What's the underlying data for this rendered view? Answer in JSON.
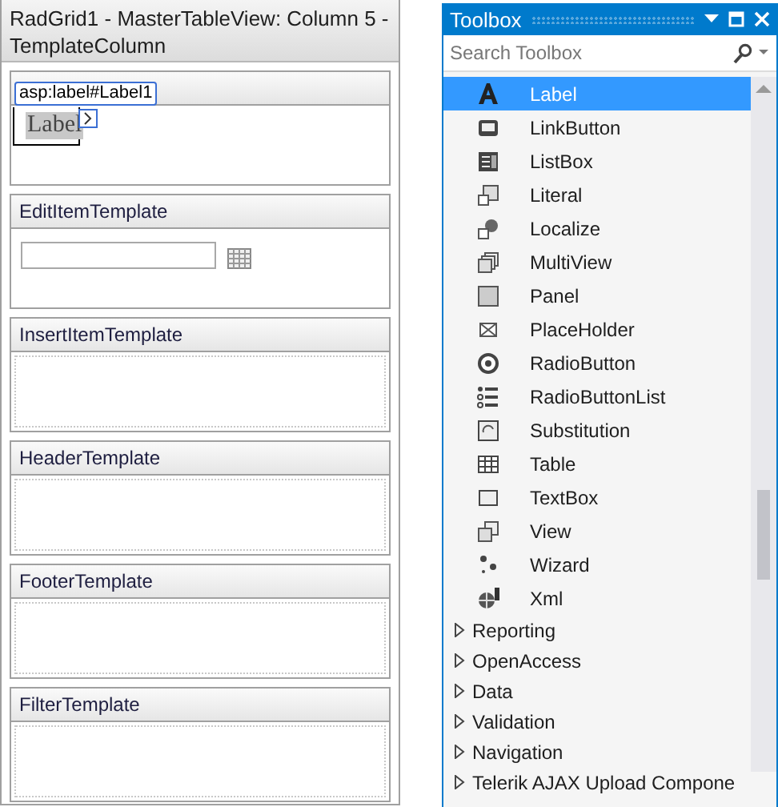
{
  "designer": {
    "title": "RadGrid1 - MasterTableView: Column 5 - TemplateColumn",
    "sections": [
      {
        "kind": "label",
        "tag": "asp:label#Label1",
        "label": "Label"
      },
      {
        "kind": "edit",
        "title": "EditItemTemplate"
      },
      {
        "kind": "empty",
        "title": "InsertItemTemplate"
      },
      {
        "kind": "empty",
        "title": "HeaderTemplate"
      },
      {
        "kind": "empty",
        "title": "FooterTemplate"
      },
      {
        "kind": "empty",
        "title": "FilterTemplate"
      }
    ]
  },
  "toolbox": {
    "title": "Toolbox",
    "search": {
      "placeholder": "Search Toolbox"
    },
    "items": [
      {
        "label": "Label",
        "selected": true
      },
      {
        "label": "LinkButton",
        "selected": false
      },
      {
        "label": "ListBox",
        "selected": false
      },
      {
        "label": "Literal",
        "selected": false
      },
      {
        "label": "Localize",
        "selected": false
      },
      {
        "label": "MultiView",
        "selected": false
      },
      {
        "label": "Panel",
        "selected": false
      },
      {
        "label": "PlaceHolder",
        "selected": false
      },
      {
        "label": "RadioButton",
        "selected": false
      },
      {
        "label": "RadioButtonList",
        "selected": false
      },
      {
        "label": "Substitution",
        "selected": false
      },
      {
        "label": "Table",
        "selected": false
      },
      {
        "label": "TextBox",
        "selected": false
      },
      {
        "label": "View",
        "selected": false
      },
      {
        "label": "Wizard",
        "selected": false
      },
      {
        "label": "Xml",
        "selected": false
      }
    ],
    "categories": [
      {
        "label": "Reporting",
        "expanded": false
      },
      {
        "label": "OpenAccess",
        "expanded": false
      },
      {
        "label": "Data",
        "expanded": false
      },
      {
        "label": "Validation",
        "expanded": false
      },
      {
        "label": "Navigation",
        "expanded": false
      },
      {
        "label": "Telerik AJAX Upload Compone",
        "expanded": false
      }
    ]
  }
}
